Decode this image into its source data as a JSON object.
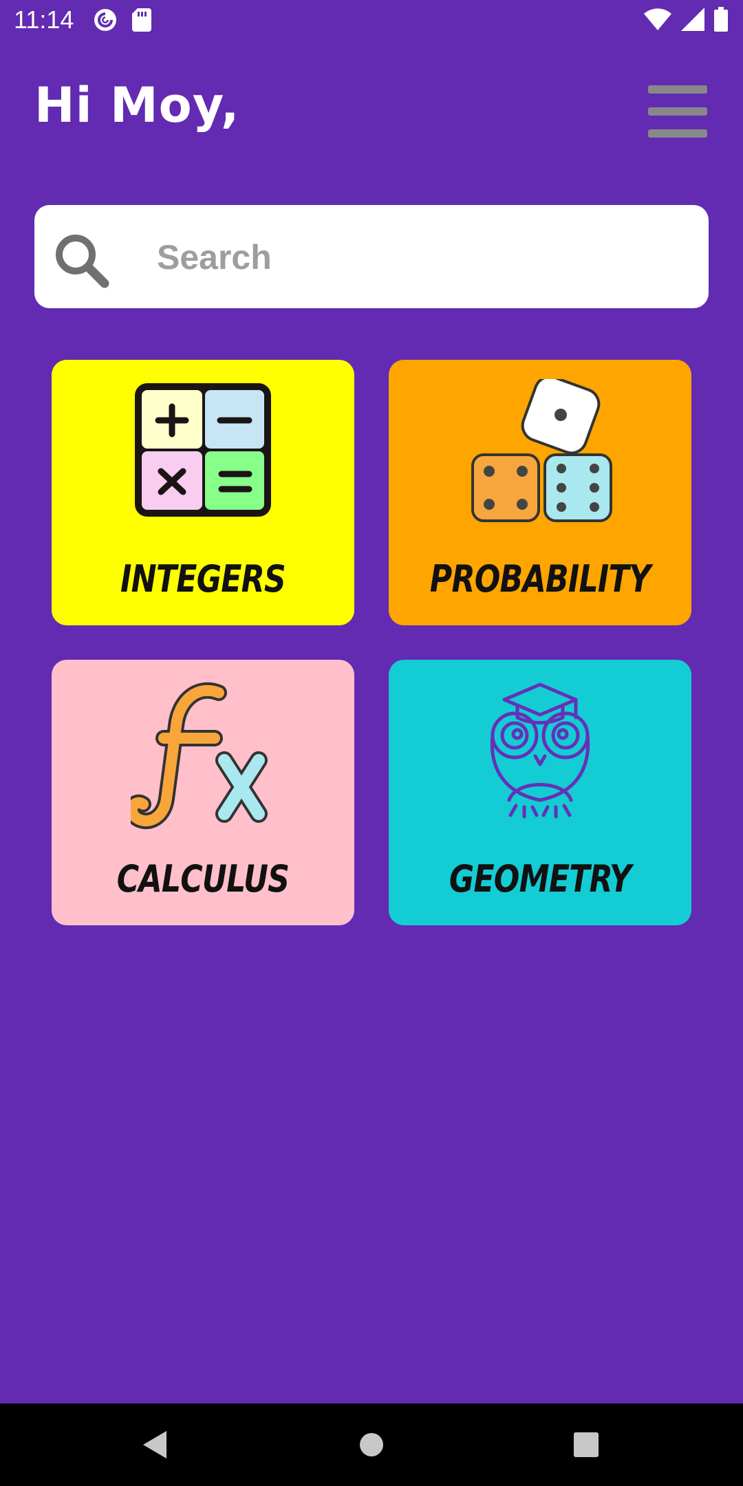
{
  "status_bar": {
    "time": "11:14",
    "left_icons": [
      "pocket-casts-icon",
      "sd-card-icon"
    ],
    "right_icons": [
      "wifi-icon",
      "signal-icon",
      "battery-icon"
    ]
  },
  "header": {
    "greeting": "Hi Moy,",
    "menu_icon": "hamburger-menu-icon"
  },
  "search": {
    "placeholder": "Search",
    "value": ""
  },
  "topics": [
    {
      "label": "INTEGERS",
      "color": "#ffff00",
      "icon": "operations-grid-icon"
    },
    {
      "label": "PROBABILITY",
      "color": "#ffa500",
      "icon": "dice-icon"
    },
    {
      "label": "CALCULUS",
      "color": "#ffc0cb",
      "icon": "function-fx-icon"
    },
    {
      "label": "GEOMETRY",
      "color": "#14ccd4",
      "icon": "owl-graduate-icon"
    }
  ],
  "nav_bar": {
    "buttons": [
      "back-icon",
      "home-icon",
      "recents-icon"
    ]
  },
  "colors": {
    "background": "#632ab2",
    "search_background": "#ffffff",
    "nav_bar": "#000000"
  }
}
